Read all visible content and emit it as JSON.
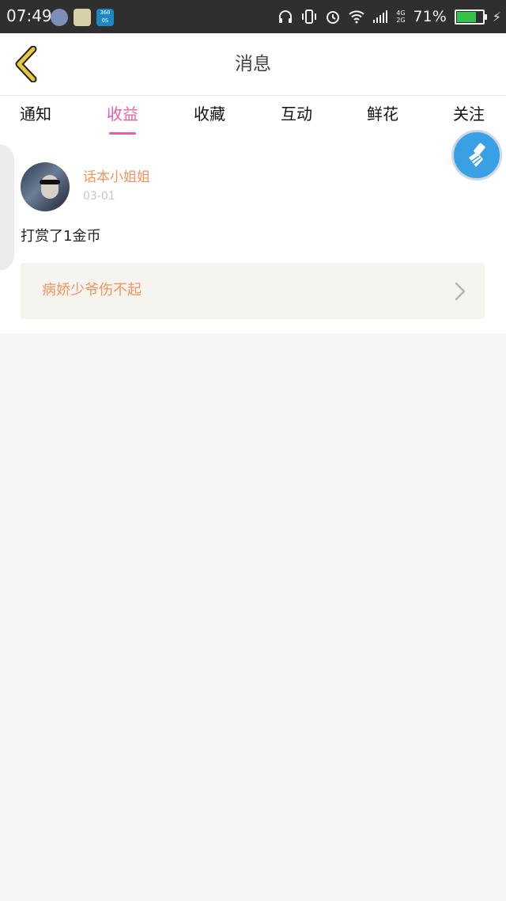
{
  "status_bar": {
    "time": "07:49",
    "network": "4G\n2G",
    "battery_percent_text": "71%",
    "battery_level": 0.71,
    "app3_label": "360\nOS"
  },
  "header": {
    "title": "消息",
    "back_icon": "chevron-left-icon"
  },
  "tabs": [
    {
      "label": "通知",
      "active": false
    },
    {
      "label": "收益",
      "active": true
    },
    {
      "label": "收藏",
      "active": false
    },
    {
      "label": "互动",
      "active": false
    },
    {
      "label": "鲜花",
      "active": false
    },
    {
      "label": "关注",
      "active": false
    }
  ],
  "message": {
    "username": "话本小姐姐",
    "date": "03-01",
    "text": "打赏了1金币",
    "book_title": "病娇少爷伤不起"
  },
  "colors": {
    "accent": "#e75f9c",
    "name_orange": "#f0955f",
    "back_yellow": "#e9c63b",
    "fab_blue": "#3aa0e6"
  },
  "fab_icon": "broom-icon"
}
